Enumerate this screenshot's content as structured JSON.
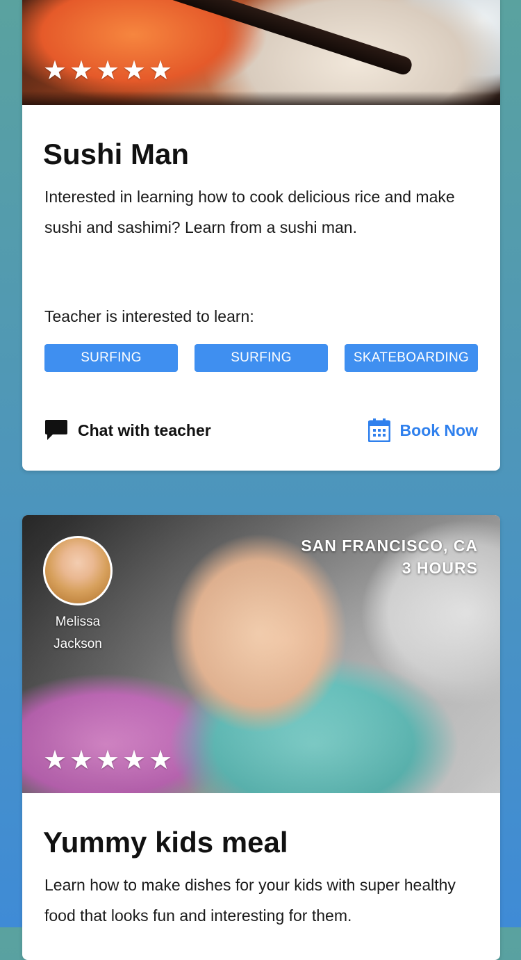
{
  "cards": [
    {
      "title": "Sushi Man",
      "description": "Interested in learning how to cook delicious rice and make sushi and sashimi? Learn from a sushi man.",
      "rating": 5,
      "stars": [
        "★",
        "★",
        "★",
        "★",
        "★"
      ],
      "learn_label": "Teacher is interested to learn:",
      "tags": [
        "SURFING",
        "SURFING",
        "SKATEBOARDING"
      ],
      "chat_label": "Chat with teacher",
      "book_label": "Book Now",
      "image_icon": "sushi-photo"
    },
    {
      "title": "Yummy kids meal",
      "description": "Learn how to make dishes for your kids with super healthy food that looks fun and interesting for them.",
      "rating": 5,
      "stars": [
        "★",
        "★",
        "★",
        "★",
        "★"
      ],
      "teacher_name_line1": "Melissa",
      "teacher_name_line2": "Jackson",
      "location": "SAN FRANCISCO, CA",
      "duration": "3 HOURS",
      "image_icon": "baby-photo"
    }
  ],
  "colors": {
    "accent": "#3f8ff0",
    "book_text": "#2f80ed",
    "background_top": "#5aa29f",
    "background_bottom": "#3f8bd6"
  }
}
